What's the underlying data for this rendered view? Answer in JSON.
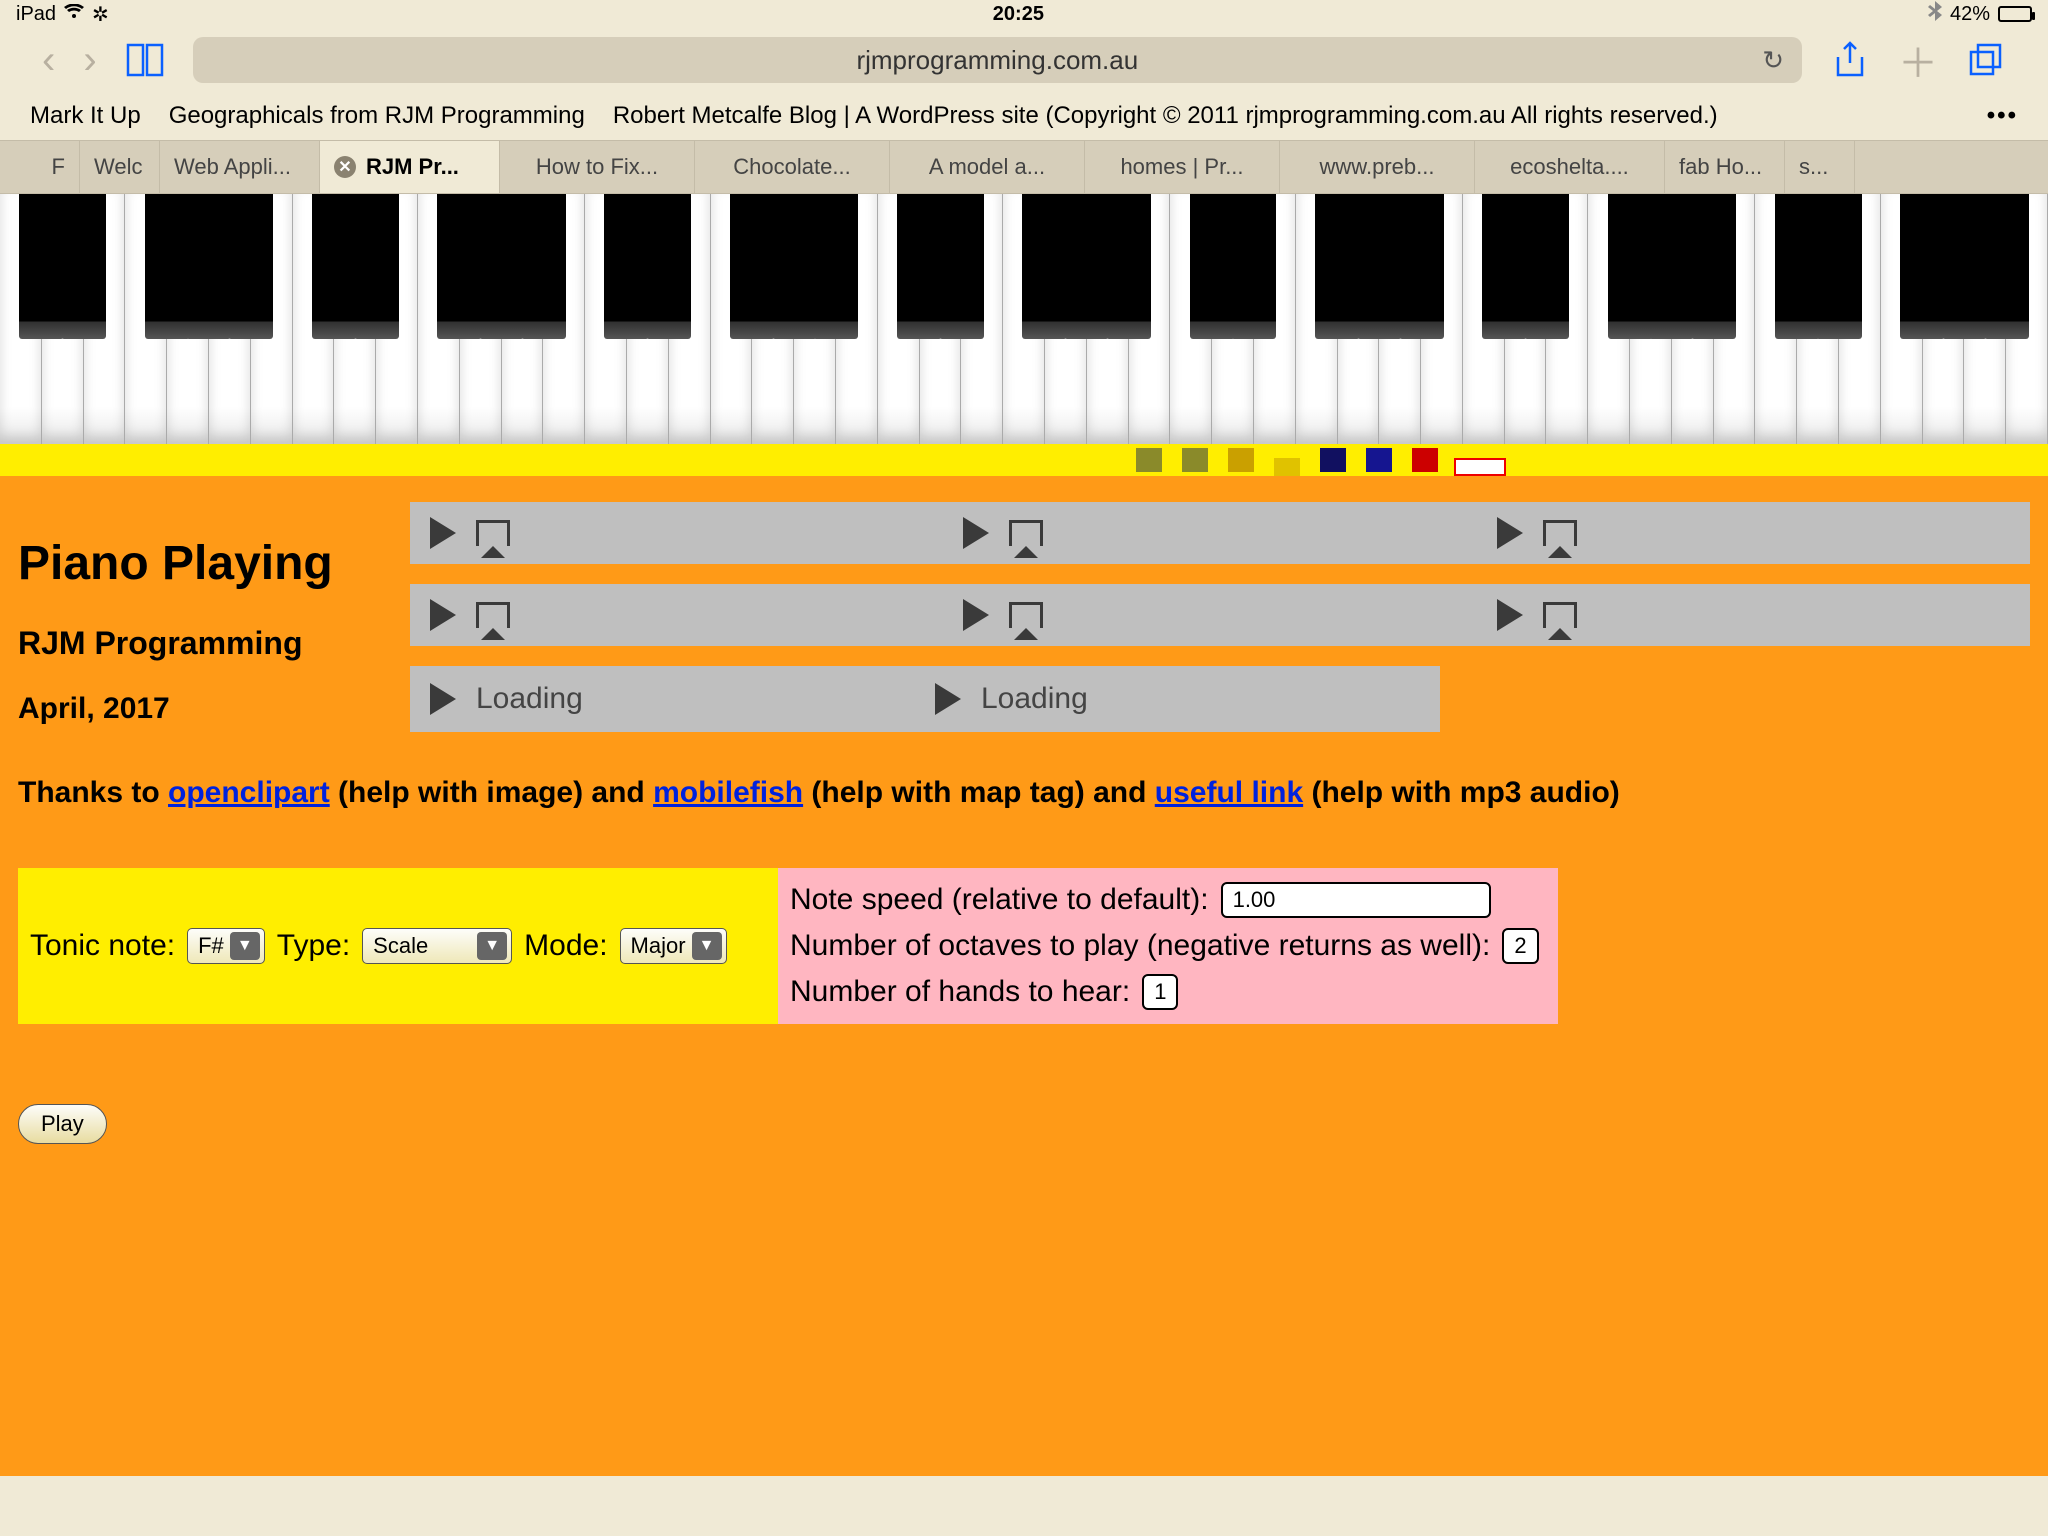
{
  "status": {
    "device": "iPad",
    "time": "20:25",
    "battery_pct": "42%"
  },
  "toolbar": {
    "url": "rjmprogramming.com.au"
  },
  "bookmarks": {
    "b1": "Mark It Up",
    "b2": "Geographicals from RJM Programming",
    "b3": "Robert Metcalfe Blog | A WordPress site (Copyright © 2011 rjmprogramming.com.au All rights reserved.)"
  },
  "tabs": {
    "t0": "F",
    "t1": "Welc",
    "t2": "Web Appli...",
    "t3": "RJM Pr...",
    "t4": "How to Fix...",
    "t5": "Chocolate...",
    "t6": "A model a...",
    "t7": "homes | Pr...",
    "t8": "www.preb...",
    "t9": "ecoshelta....",
    "t10": "fab Ho...",
    "t11": "s..."
  },
  "headings": {
    "h1": "Piano Playing",
    "h2": "RJM Programming",
    "h3": "April, 2017"
  },
  "players": {
    "loading": "Loading"
  },
  "thanks": {
    "t1": "Thanks to ",
    "a1": "openclipart",
    "t2": " (help with image) and ",
    "a2": "mobilefish",
    "t3": " (help with map tag) and ",
    "a3": "useful link",
    "t4": " (help with mp3 audio)"
  },
  "controls": {
    "tonic_label": "Tonic note:",
    "tonic_value": "F#",
    "type_label": "Type:",
    "type_value": "Scale",
    "mode_label": "Mode:",
    "mode_value": "Major",
    "speed_label": "Note speed (relative to default):",
    "speed_value": "1.00",
    "octaves_label": "Number of octaves to play (negative returns as well):",
    "octaves_value": "2",
    "hands_label": "Number of hands to hear:",
    "hands_value": "1",
    "play": "Play"
  }
}
